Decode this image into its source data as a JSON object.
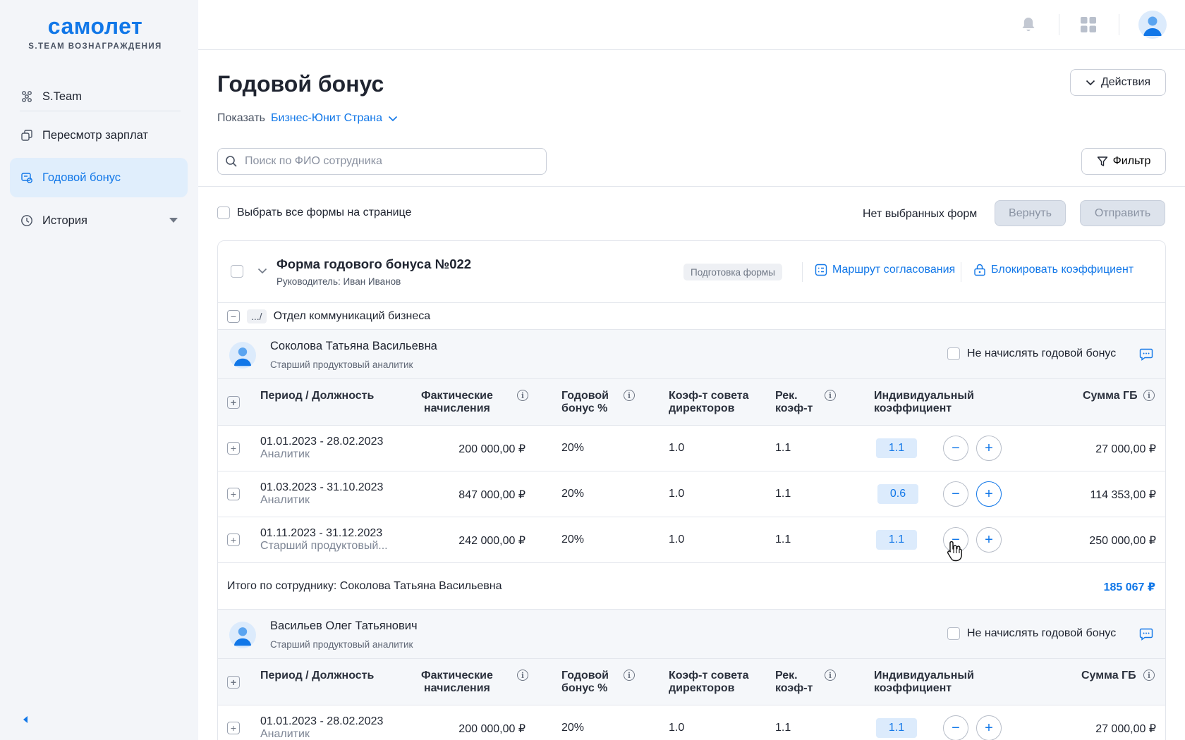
{
  "sidebar": {
    "logo": "самолет",
    "logo_sub": "S.TEAM ВОЗНАГРАЖДЕНИЯ",
    "items": [
      {
        "label": "S.Team",
        "icon": "team-icon"
      },
      {
        "label": "Пересмотр зарплат",
        "icon": "copy-icon"
      },
      {
        "label": "Годовой бонус",
        "icon": "bonus-icon",
        "active": true
      },
      {
        "label": "История",
        "icon": "clock-icon"
      }
    ]
  },
  "topbar": {
    "icons": [
      "bell-icon",
      "apps-grid-icon",
      "user-avatar"
    ]
  },
  "page": {
    "title": "Годовой бонус",
    "actions_label": "Действия",
    "show_label": "Показать",
    "show_value": "Бизнес-Юнит Страна",
    "search_placeholder": "Поиск по ФИО сотрудника",
    "filter_label": "Фильтр",
    "select_all_label": "Выбрать все формы на странице",
    "no_selected": "Нет выбранных форм",
    "return_label": "Вернуть",
    "send_label": "Отправить"
  },
  "form": {
    "title": "Форма годового бонуса №022",
    "manager": "Руководитель: Иван Иванов",
    "status": "Подготовка формы",
    "route_link": "Маршрут согласования",
    "lock_link": "Блокировать коэффициент",
    "dept_crumb": ".../",
    "dept_name": "Отдел коммуникаций бизнеса"
  },
  "table_headers": {
    "period": "Период / Должность",
    "actual_1": "Фактические",
    "actual_2": "начисления",
    "bonus_1": "Годовой",
    "bonus_2": "бонус %",
    "board_1": "Коэф-т совета",
    "board_2": "директоров",
    "rec_1": "Рек.",
    "rec_2": "коэф-т",
    "ind_1": "Индивидуальный",
    "ind_2": "коэффициент",
    "sum": "Сумма ГБ"
  },
  "employees": [
    {
      "name": "Соколова Татьяна Васильевна",
      "role": "Старший продуктовый аналитик",
      "no_bonus_label": "Не начислять годовой бонус",
      "rows": [
        {
          "period": "01.01.2023 - 28.02.2023",
          "position": "Аналитик",
          "actual": "200 000,00 ₽",
          "bonus": "20%",
          "board": "1.0",
          "rec": "1.1",
          "ind": "1.1",
          "sum": "27 000,00 ₽"
        },
        {
          "period": "01.03.2023 - 31.10.2023",
          "position": "Аналитик",
          "actual": "847 000,00 ₽",
          "bonus": "20%",
          "board": "1.0",
          "rec": "1.1",
          "ind": "0.6",
          "sum": "114 353,00 ₽"
        },
        {
          "period": "01.11.2023 - 31.12.2023",
          "position": "Старший продуктовый...",
          "actual": "242 000,00 ₽",
          "bonus": "20%",
          "board": "1.0",
          "rec": "1.1",
          "ind": "1.1",
          "sum": "250 000,00 ₽"
        }
      ],
      "total_label": "Итого по сотруднику: Соколова Татьяна Васильевна",
      "total_value": "185 067 ₽"
    },
    {
      "name": "Васильев Олег Татьянович",
      "role": "Старший продуктовый аналитик",
      "no_bonus_label": "Не начислять годовой бонус",
      "rows": [
        {
          "period": "01.01.2023 - 28.02.2023",
          "position": "Аналитик",
          "actual": "200 000,00 ₽",
          "bonus": "20%",
          "board": "1.0",
          "rec": "1.1",
          "ind": "1.1",
          "sum": "27 000,00 ₽"
        }
      ]
    }
  ],
  "symbols": {
    "minus": "−",
    "plus": "+",
    "info": "i"
  },
  "colors": {
    "accent": "#1177e8",
    "sidebar_bg": "#f3f5f9",
    "active_bg": "#e0eefc",
    "coef_bg": "#dcebfc"
  }
}
